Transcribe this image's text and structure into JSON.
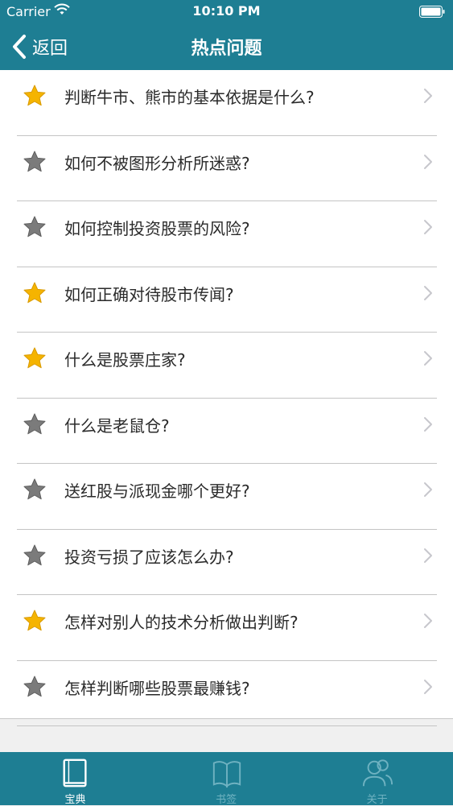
{
  "status": {
    "carrier": "Carrier",
    "time": "10:10 PM"
  },
  "nav": {
    "back_label": "返回",
    "title": "热点问题"
  },
  "colors": {
    "accent": "#1e7e93",
    "star_gold": "#f5b400",
    "star_gray": "#7b7b7b"
  },
  "questions": [
    {
      "label": "判断牛市、熊市的基本依据是什么?",
      "starred": true
    },
    {
      "label": "如何不被图形分析所迷惑?",
      "starred": false
    },
    {
      "label": "如何控制投资股票的风险?",
      "starred": false
    },
    {
      "label": "如何正确对待股市传闻?",
      "starred": true
    },
    {
      "label": "什么是股票庄家?",
      "starred": true
    },
    {
      "label": "什么是老鼠仓?",
      "starred": false
    },
    {
      "label": "送红股与派现金哪个更好?",
      "starred": false
    },
    {
      "label": "投资亏损了应该怎么办?",
      "starred": false
    },
    {
      "label": "怎样对别人的技术分析做出判断?",
      "starred": true
    },
    {
      "label": "怎样判断哪些股票最赚钱?",
      "starred": false
    }
  ],
  "tabs": [
    {
      "label": "宝典",
      "icon": "book-closed-icon",
      "active": true
    },
    {
      "label": "书签",
      "icon": "book-open-icon",
      "active": false
    },
    {
      "label": "关于",
      "icon": "people-icon",
      "active": false
    }
  ]
}
